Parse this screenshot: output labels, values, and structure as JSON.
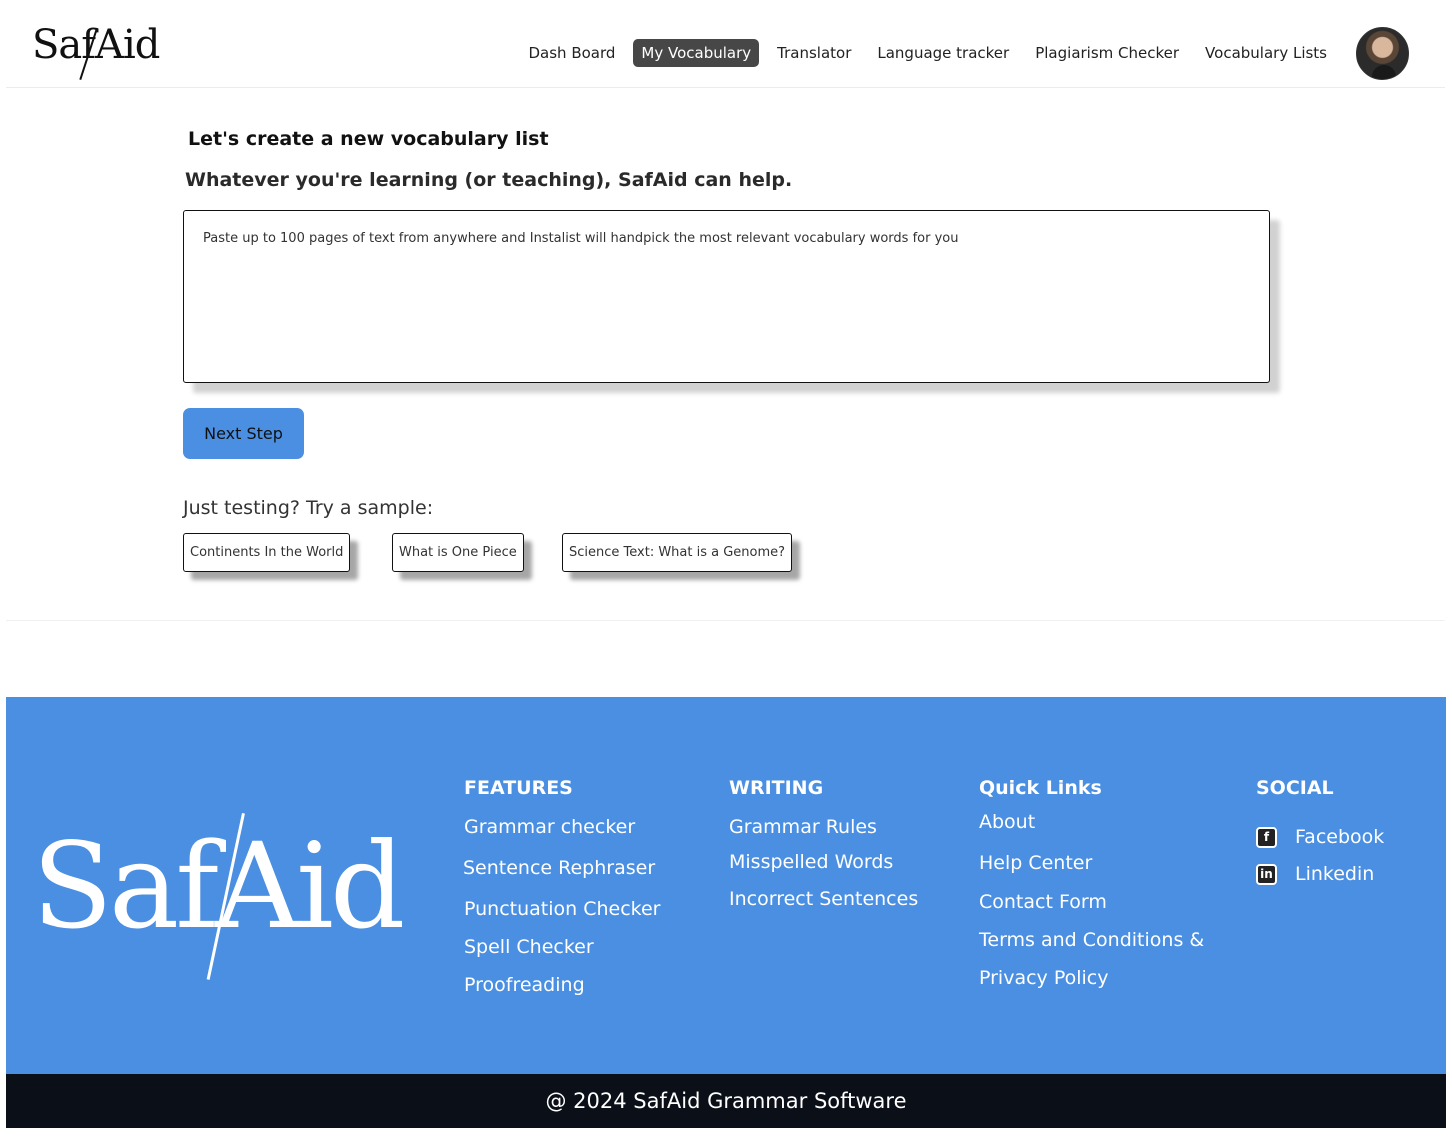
{
  "header": {
    "logo_text": "SafAid",
    "nav": [
      "Dash Board",
      "My Vocabulary",
      "Translator",
      "Language tracker",
      "Plagiarism Checker",
      "Vocabulary Lists"
    ],
    "active_nav": "My Vocabulary"
  },
  "main": {
    "title": "Let's create a new vocabulary list",
    "subtitle": "Whatever you're learning (or teaching), SafAid can help.",
    "textarea_placeholder": "Paste up to 100 pages of text from anywhere and Instalist will handpick the most relevant vocabulary words for you",
    "next_button": "Next Step",
    "sample_label": "Just testing? Try a sample:",
    "samples": [
      "Continents In the World",
      "What is One Piece",
      "Science Text: What is a Genome?"
    ]
  },
  "footer": {
    "logo_text": "SafAid",
    "features": {
      "heading": "FEATURES",
      "links": [
        "Grammar checker",
        "Sentence Rephraser",
        "Punctuation Checker",
        "Spell Checker",
        "Proofreading"
      ]
    },
    "writing": {
      "heading": "WRITING",
      "links": [
        "Grammar Rules",
        "Misspelled Words",
        "Incorrect Sentences"
      ]
    },
    "quick_links": {
      "heading": "Quick Links",
      "links": [
        "About",
        "Help Center",
        "Contact Form",
        "Terms and Conditions &",
        "Privacy Policy"
      ]
    },
    "social": {
      "heading": "SOCIAL",
      "links": [
        "Facebook",
        "Linkedin"
      ]
    },
    "copyright": "@ 2024  SafAid Grammar Software"
  },
  "colors": {
    "primary_blue": "#4a8fe2",
    "nav_active": "#474747",
    "footer_bottom": "#0b0f18"
  }
}
